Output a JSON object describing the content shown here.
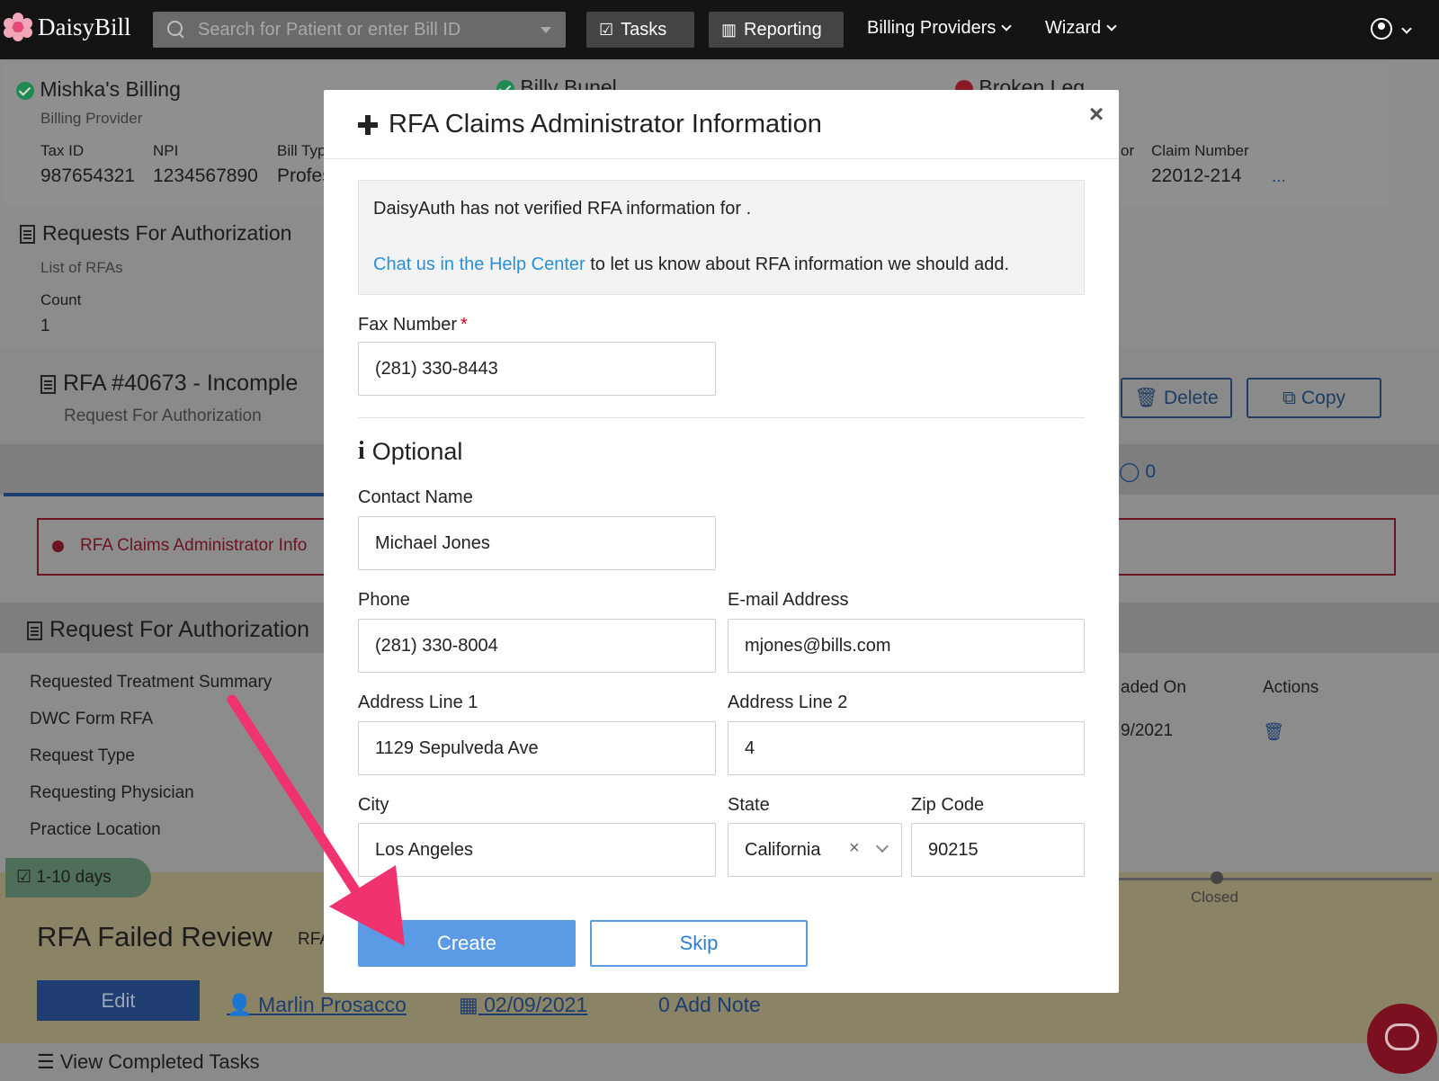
{
  "nav": {
    "logo": "DaisyBill",
    "search_placeholder": "Search for Patient or enter Bill ID",
    "tasks": "Tasks",
    "reporting": "Reporting",
    "billing_providers": "Billing Providers",
    "wizard": "Wizard"
  },
  "background": {
    "provider_name": "Mishka's Billing",
    "provider_role": "Billing Provider",
    "tax_id_label": "Tax ID",
    "tax_id": "987654321",
    "npi_label": "NPI",
    "npi": "1234567890",
    "bill_type_label": "Bill Typ",
    "bill_type": "Profes",
    "patient_name": "Billy Bunel",
    "injury_name": "Broken Leg",
    "claim_admin_frag": "or",
    "claim_number_label": "Claim Number",
    "claim_number": "22012-214",
    "ellipsis": "...",
    "rfa_section_title": "Requests For Authorization",
    "rfa_list_sub": "List of RFAs",
    "count_label": "Count",
    "count": "1",
    "rfa_title": "RFA #40673 - Incomple",
    "rfa_subtitle": "Request For Authorization",
    "delete_btn": "Delete",
    "copy_btn": "Copy",
    "notes_count": "0",
    "alert_text": "RFA Claims Administrator Info",
    "rfa_details_title": "Request For Authorization",
    "detail_rows": [
      "Requested Treatment Summary",
      "DWC Form RFA",
      "Request Type",
      "Requesting Physician",
      "Practice Location"
    ],
    "uploaded_on_label": "aded On",
    "actions_label": "Actions",
    "uploaded_date": "9/2021",
    "sla_pill": "1-10 days",
    "closed_label": "Closed",
    "task_title": "RFA Failed Review",
    "task_tag": "RFA",
    "edit_btn": "Edit",
    "assignee": "Marlin Prosacco",
    "due_date": "02/09/2021",
    "add_note": "0 Add Note",
    "view_completed": "View Completed Tasks"
  },
  "modal": {
    "title": "RFA Claims Administrator Information",
    "info_line1": "DaisyAuth has not verified RFA information for .",
    "help_link": "Chat us in the Help Center",
    "help_rest": " to let us know about RFA information we should add.",
    "fax_label": "Fax Number",
    "required_mark": "*",
    "fax_value": "(281) 330-8443",
    "optional_label": "Optional",
    "contact_label": "Contact Name",
    "contact_value": "Michael Jones",
    "phone_label": "Phone",
    "phone_value": "(281) 330-8004",
    "email_label": "E-mail Address",
    "email_value": "mjones@bills.com",
    "address1_label": "Address Line 1",
    "address1_value": "1129 Sepulveda Ave",
    "address2_label": "Address Line 2",
    "address2_value": "4",
    "city_label": "City",
    "city_value": "Los Angeles",
    "state_label": "State",
    "state_value": "California",
    "zip_label": "Zip Code",
    "zip_value": "90215",
    "create_btn": "Create",
    "skip_btn": "Skip"
  },
  "colors": {
    "accent": "#5b9be6",
    "link": "#2b8fd8",
    "required": "#d0021b",
    "annotation_arrow": "#f0336f"
  }
}
